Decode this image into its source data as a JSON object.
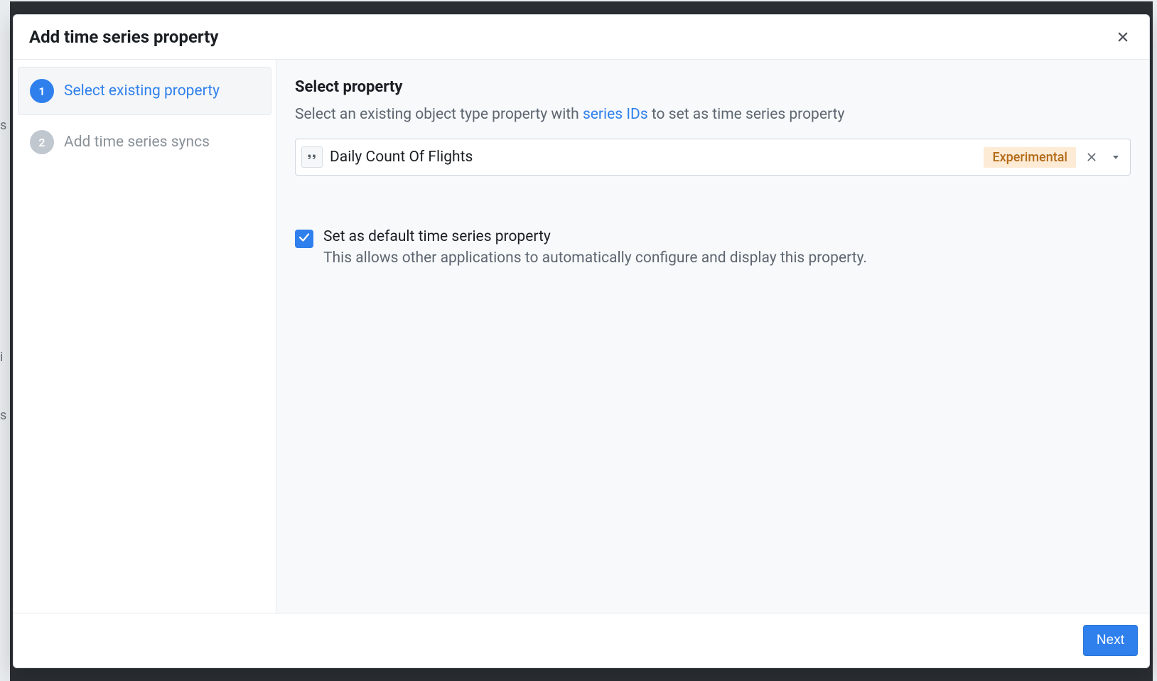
{
  "modal": {
    "title": "Add time series property"
  },
  "sidebar": {
    "steps": [
      {
        "num": "1",
        "label": "Select existing property"
      },
      {
        "num": "2",
        "label": "Add time series syncs"
      }
    ]
  },
  "content": {
    "section_title": "Select property",
    "desc_pre": "Select an existing object type property with ",
    "desc_link": "series IDs",
    "desc_post": " to set as time series property",
    "select": {
      "value": "Daily Count Of Flights",
      "tag": "Experimental"
    },
    "checkbox": {
      "checked": true,
      "label": "Set as default time series property",
      "sub": "This allows other applications to automatically configure and display this property."
    }
  },
  "footer": {
    "next": "Next"
  },
  "peek": {
    "a": "s",
    "b": "i",
    "c": "s"
  }
}
